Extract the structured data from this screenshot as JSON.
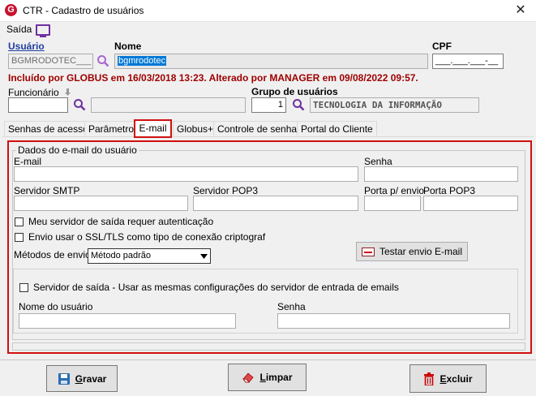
{
  "window": {
    "title": "CTR - Cadastro de usuários",
    "close_glyph": "✕",
    "logo_letter": "G"
  },
  "menu": {
    "saida": "Saída"
  },
  "header": {
    "usuario_label": "Usuário",
    "usuario_value": "BGMRODOTEC___",
    "nome_label": "Nome",
    "nome_value": "bgmrodotec",
    "cpf_label": "CPF",
    "cpf_value": "___.___.___-__"
  },
  "info_line": "Incluído por GLOBUS em 16/03/2018 13:23. Alterado por MANAGER em 09/08/2022 09:57.",
  "funcionario": {
    "label": "Funcionário",
    "value": "",
    "name_value": ""
  },
  "grupo": {
    "label": "Grupo de usuários",
    "code": "1",
    "name": "TECNOLOGIA DA INFORMAÇÃO"
  },
  "tabs": [
    {
      "label": "Senhas de acesso"
    },
    {
      "label": "Parâmetros"
    },
    {
      "label": "E-mail"
    },
    {
      "label": "Globus+"
    },
    {
      "label": "Controle de senhas"
    },
    {
      "label": "Portal do Cliente"
    }
  ],
  "email_tab": {
    "group_title": "Dados do e-mail do usuário",
    "email_label": "E-mail",
    "email_value": "",
    "senha_label": "Senha",
    "smtp_label": "Servidor SMTP",
    "pop3_label": "Servidor POP3",
    "porta_envio_label": "Porta p/ envio",
    "porta_pop3_label": "Porta POP3",
    "auth_checkbox": "Meu servidor de saída requer autenticação",
    "ssl_checkbox": "Envio usar o SSL/TLS como tipo de conexão criptograf",
    "metodos_label": "Métodos de envio",
    "metodos_value": "Método padrão",
    "testar_button": "Testar envio E-mail",
    "servidor_saida_checkbox": "Servidor de saída - Usar as mesmas configurações do servidor de entrada de emails",
    "nome_usuario_label": "Nome do usuário",
    "senha2_label": "Senha"
  },
  "footer": {
    "gravar": "Gravar",
    "limpar": "Limpar",
    "excluir": "Excluir"
  },
  "colors": {
    "accent_red": "#d01010",
    "info_red": "#a00000",
    "purple": "#7030a0"
  }
}
